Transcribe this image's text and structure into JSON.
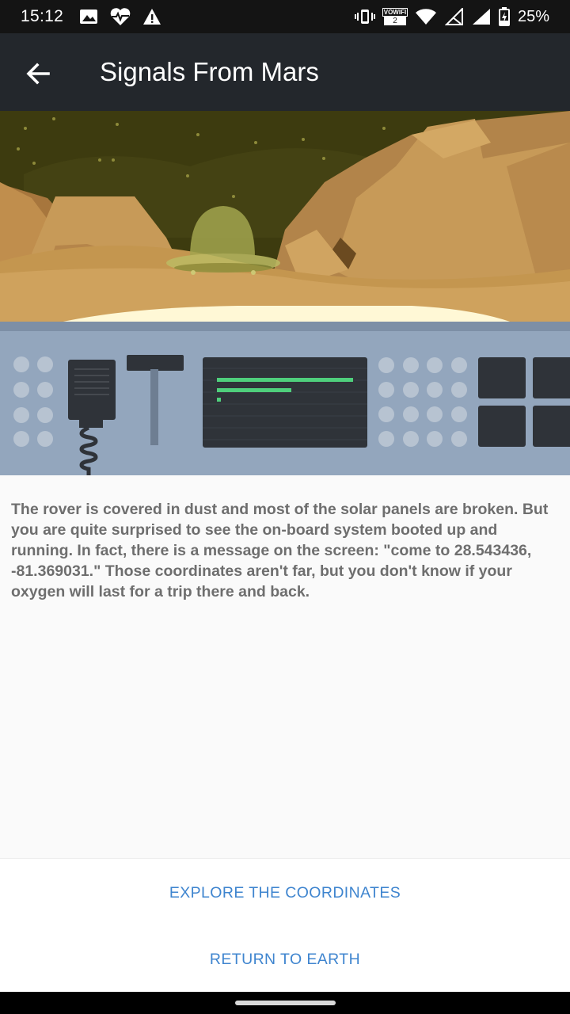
{
  "status_bar": {
    "time": "15:12",
    "battery_percent": "25%",
    "vowifi_label": "VOWIFI",
    "network_badge": "2",
    "left_icons": [
      "image-icon",
      "heart-monitor-icon",
      "warning-icon"
    ],
    "right_icons": [
      "vibrate-icon",
      "vowifi-icon",
      "wifi-icon",
      "signal-empty-icon",
      "signal-full-icon",
      "battery-charging-icon"
    ]
  },
  "app_bar": {
    "title": "Signals From Mars",
    "back_icon": "arrow-back-icon"
  },
  "illustration": {
    "description_icon": "mars-rover-console-illustration",
    "colors": {
      "sky": "#3d3b0f",
      "rock": "#c79a58",
      "ground": "#c4964f",
      "console": "#93a6bd",
      "screen": "#2f3339",
      "screen_line": "#4fcf7c",
      "ufo": "#a3a54e"
    }
  },
  "story": {
    "text": "The rover is covered in dust and most of the solar panels are broken. But you are quite surprised to see the on-board system booted up and running. In fact, there is a message on the screen: \"come to 28.543436, -81.369031.\" Those coordinates aren't far, but you don't know if your oxygen will last for a trip there and back."
  },
  "actions": {
    "explore_label": "EXPLORE THE COORDINATES",
    "return_label": "RETURN TO EARTH",
    "accent_color": "#3f85cf"
  }
}
